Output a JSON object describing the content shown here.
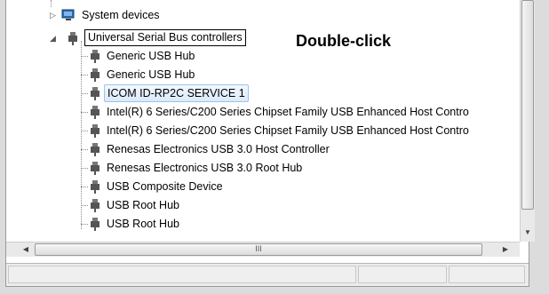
{
  "tree": {
    "categories": [
      {
        "label": "System devices",
        "expanded": false
      },
      {
        "label": "Universal Serial Bus controllers",
        "expanded": true
      }
    ],
    "devices": [
      "Generic USB Hub",
      "Generic USB Hub",
      "ICOM ID-RP2C SERVICE 1",
      "Intel(R) 6 Series/C200 Series Chipset Family USB Enhanced Host Contro",
      "Intel(R) 6 Series/C200 Series Chipset Family USB Enhanced Host Contro",
      "Renesas Electronics USB 3.0 Host Controller",
      "Renesas Electronics USB 3.0 Root Hub",
      "USB Composite Device",
      "USB Root Hub",
      "USB Root Hub"
    ],
    "selected_device": "ICOM ID-RP2C SERVICE 1"
  },
  "annotation": {
    "text": "Double-click"
  },
  "scrollbar": {
    "hthumb_grip": "III"
  },
  "colors": {
    "selection_border": "#9cc4ea",
    "tree_lines": "#8a8a8a"
  }
}
